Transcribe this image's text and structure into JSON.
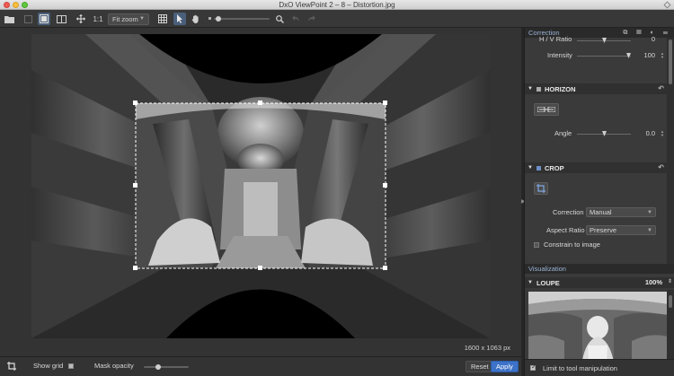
{
  "window": {
    "title": "DxO ViewPoint 2 – 8 – Distortion.jpg"
  },
  "toolbar": {
    "zoom_ratio": "1:1",
    "zoom_mode": "Fit zoom",
    "icons": [
      "folder-icon",
      "single-view-icon",
      "split-view-icon",
      "compare-view-icon",
      "move-icon",
      "grid-icon",
      "pointer-icon",
      "hand-icon",
      "zoom-slider",
      "zoom-icon",
      "undo-icon",
      "redo-icon"
    ]
  },
  "canvas": {
    "dimension_readout": "1600 x 1063 px"
  },
  "bottom_bar": {
    "show_grid_label": "Show grid",
    "show_grid_checked": false,
    "mask_opacity_label": "Mask opacity",
    "mask_opacity_value": 0.3,
    "reset_label": "Reset",
    "apply_label": "Apply"
  },
  "panel": {
    "header": "Correction",
    "ratio_row": {
      "label": "H / V Ratio",
      "value": "0"
    },
    "intensity_row": {
      "label": "Intensity",
      "value": "100"
    },
    "horizon": {
      "title": "HORIZON",
      "angle_label": "Angle",
      "angle_value": "0.0"
    },
    "crop": {
      "title": "CROP",
      "correction_label": "Correction",
      "correction_value": "Manual",
      "aspect_ratio_label": "Aspect Ratio",
      "aspect_ratio_value": "Preserve",
      "constrain_label": "Constrain to image",
      "constrain_checked": false
    },
    "visualization": {
      "header": "Visualization",
      "loupe_title": "LOUPE",
      "loupe_zoom": "100%"
    },
    "limit_label": "Limit to tool manipulation",
    "limit_checked": true
  },
  "colors": {
    "accent": "#3c72c8",
    "panel_header_text": "#9ab3d6"
  }
}
